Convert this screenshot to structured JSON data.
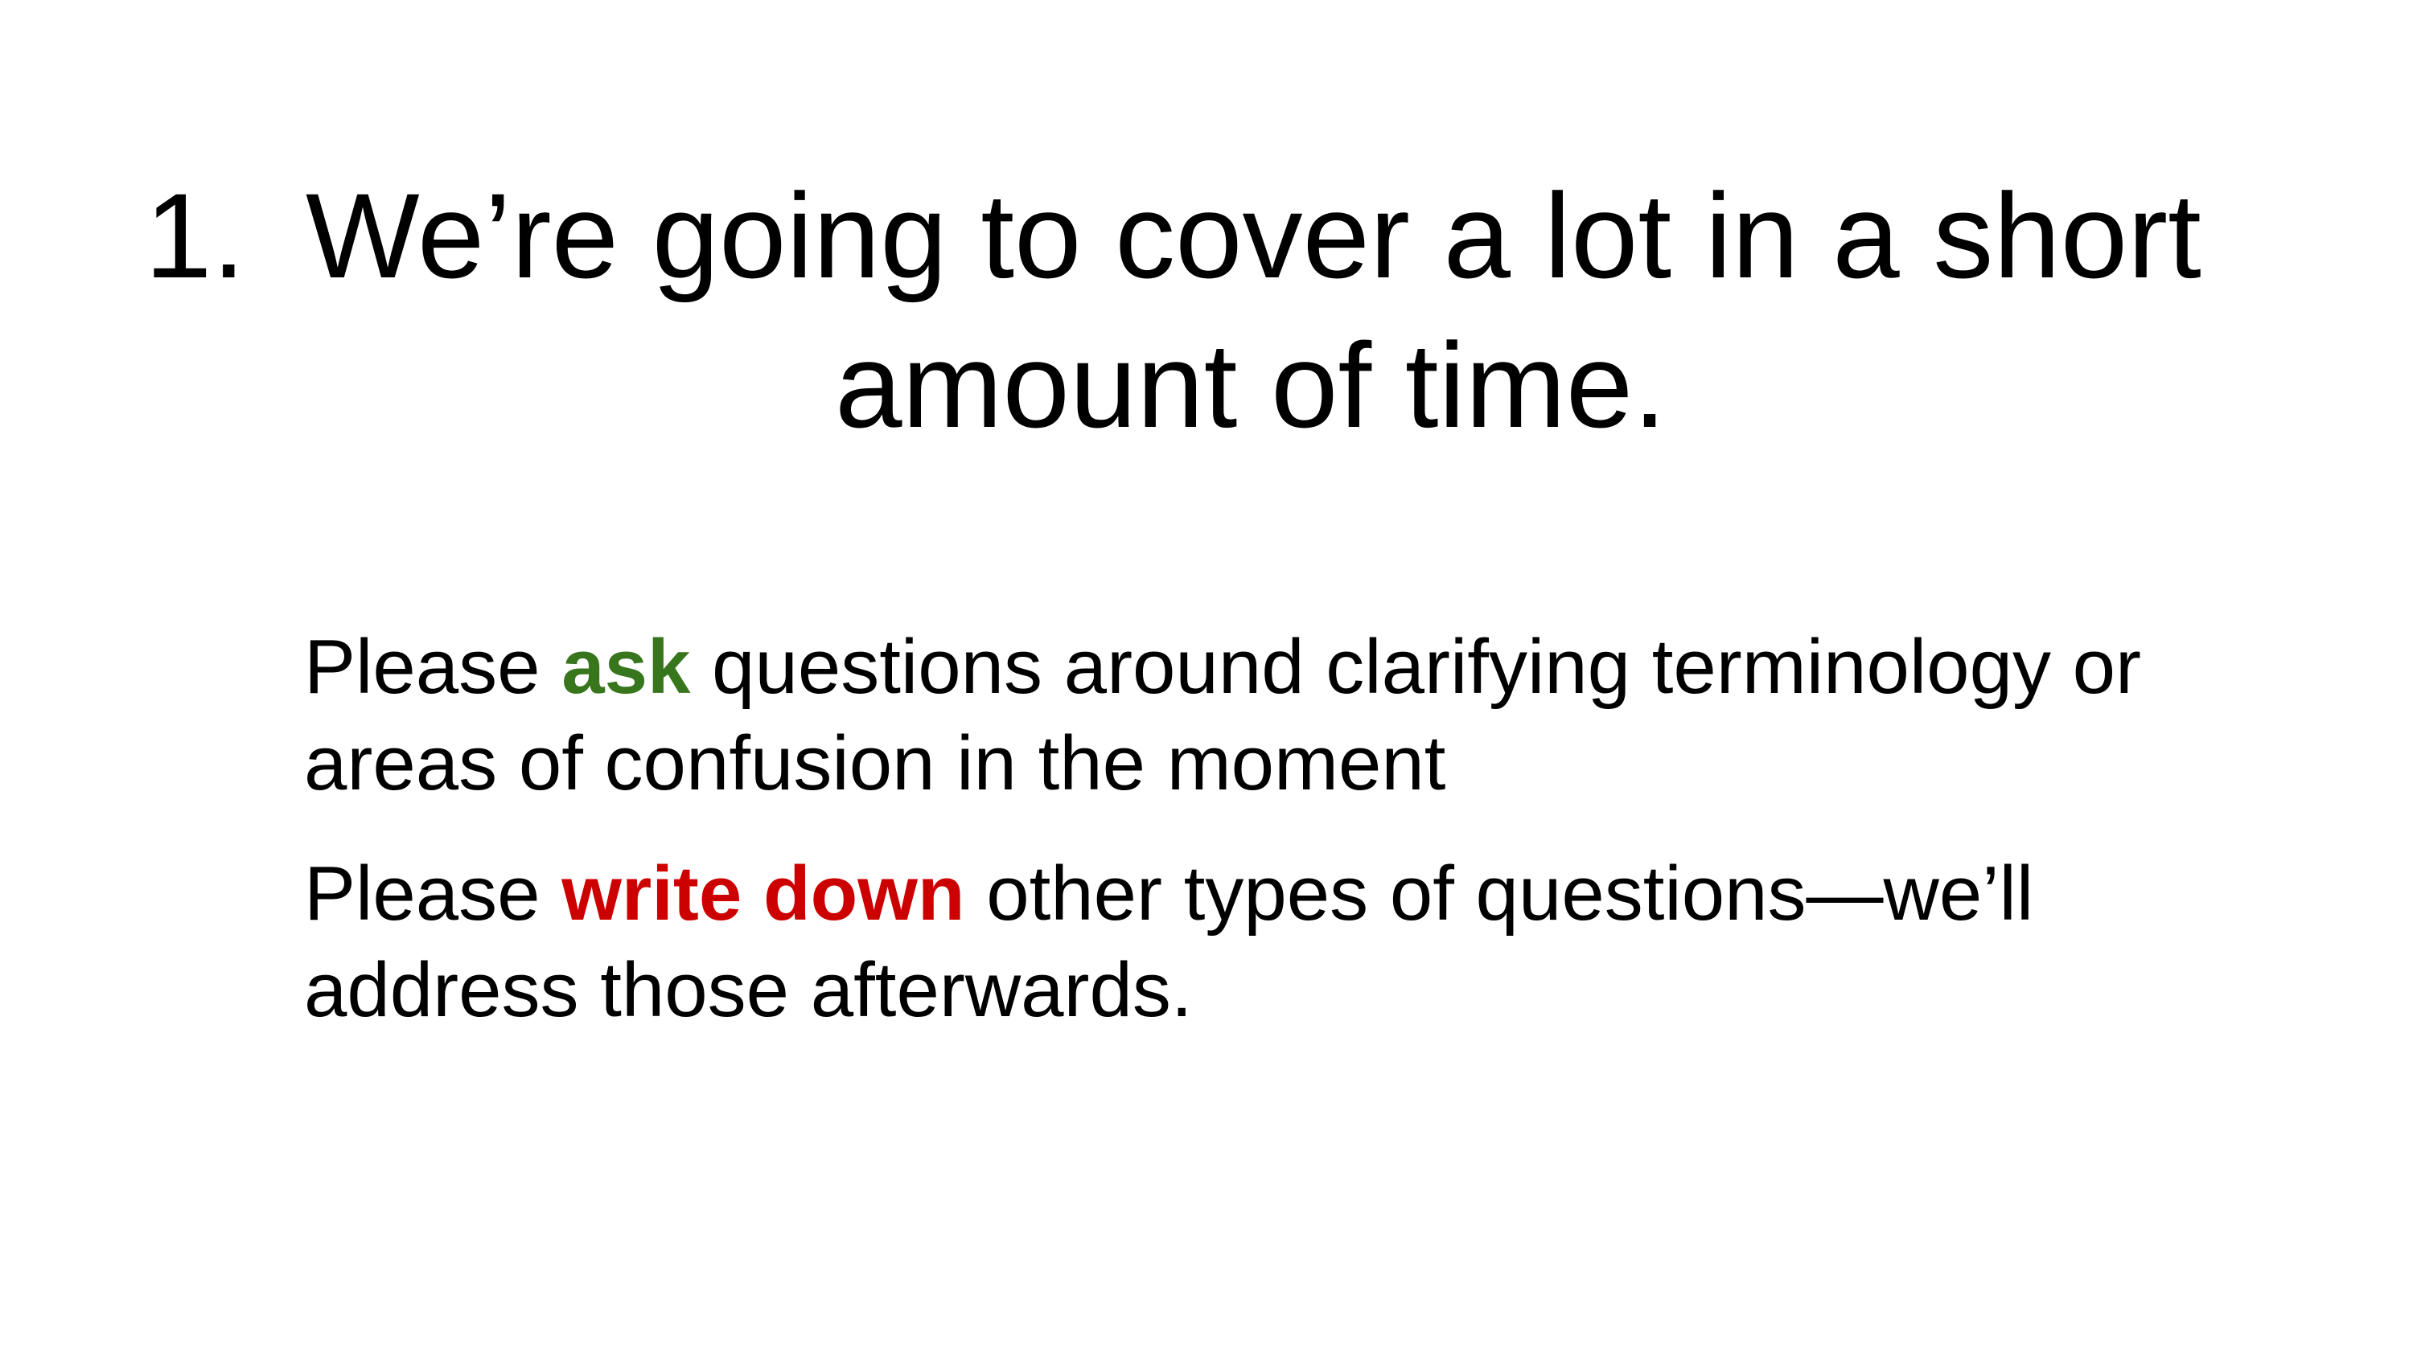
{
  "slide": {
    "title": {
      "number": "1.",
      "line1": "We’re going to cover a lot in a short",
      "line2": "amount of time."
    },
    "paragraphs": [
      {
        "before": "Please ",
        "highlight": "ask",
        "after": " questions around clarifying terminology or areas of confusion in the moment"
      },
      {
        "before": "Please ",
        "highlight": "write down",
        "after": " other types of questions—we’ll address those afterwards."
      }
    ]
  },
  "colors": {
    "ask_highlight": "#38761d",
    "write_down_highlight": "#cc0000",
    "text": "#000000",
    "background": "#ffffff"
  }
}
